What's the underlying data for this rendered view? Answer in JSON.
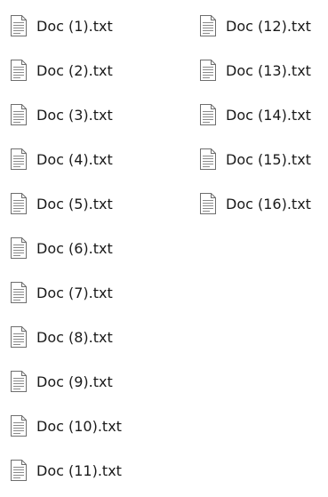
{
  "explorer": {
    "files": [
      {
        "name": "Doc (1).txt",
        "icon": "text-file-icon"
      },
      {
        "name": "Doc (2).txt",
        "icon": "text-file-icon"
      },
      {
        "name": "Doc (3).txt",
        "icon": "text-file-icon"
      },
      {
        "name": "Doc (4).txt",
        "icon": "text-file-icon"
      },
      {
        "name": "Doc (5).txt",
        "icon": "text-file-icon"
      },
      {
        "name": "Doc (6).txt",
        "icon": "text-file-icon"
      },
      {
        "name": "Doc (7).txt",
        "icon": "text-file-icon"
      },
      {
        "name": "Doc (8).txt",
        "icon": "text-file-icon"
      },
      {
        "name": "Doc (9).txt",
        "icon": "text-file-icon"
      },
      {
        "name": "Doc (10).txt",
        "icon": "text-file-icon"
      },
      {
        "name": "Doc (11).txt",
        "icon": "text-file-icon"
      },
      {
        "name": "Doc (12).txt",
        "icon": "text-file-icon"
      },
      {
        "name": "Doc (13).txt",
        "icon": "text-file-icon"
      },
      {
        "name": "Doc (14).txt",
        "icon": "text-file-icon"
      },
      {
        "name": "Doc (15).txt",
        "icon": "text-file-icon"
      },
      {
        "name": "Doc (16).txt",
        "icon": "text-file-icon"
      }
    ]
  }
}
